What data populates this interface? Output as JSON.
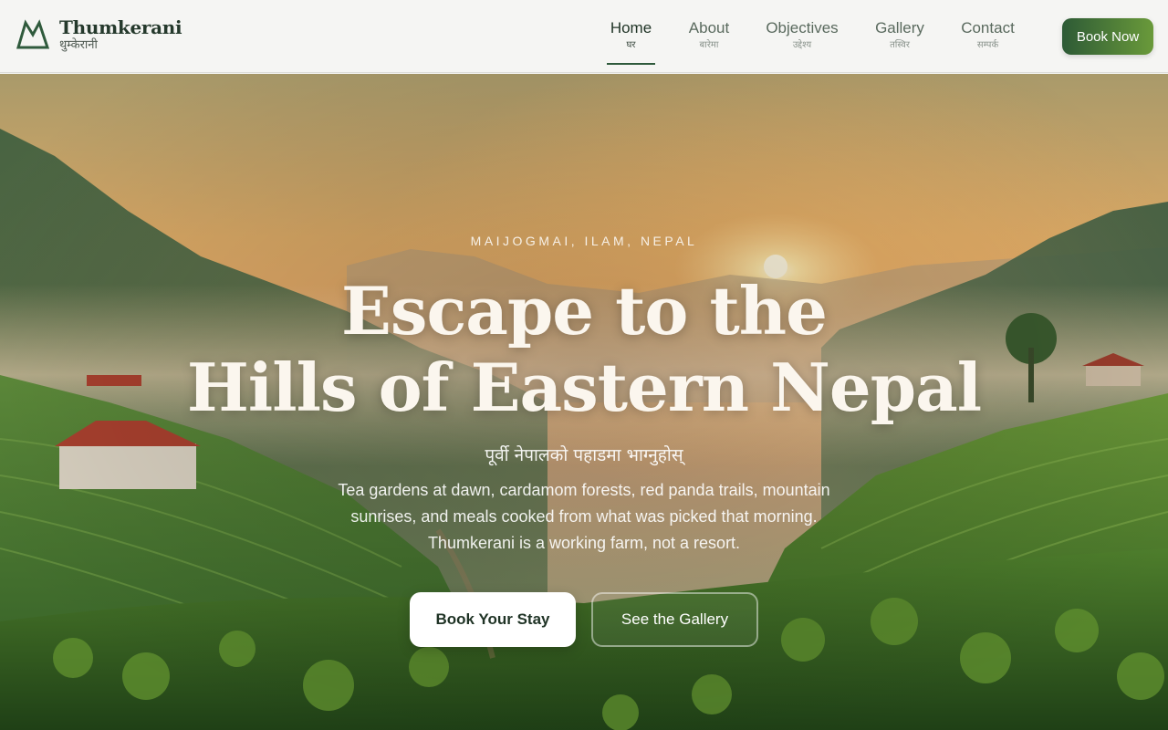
{
  "brand": {
    "name": "Thumkerani",
    "subtitle": "थुम्केरानी",
    "logo_icon": "mountain-icon",
    "accent": "#2f5a3c"
  },
  "nav": {
    "items": [
      {
        "label": "Home",
        "sub": "घर",
        "active": true
      },
      {
        "label": "About",
        "sub": "बारेमा",
        "active": false
      },
      {
        "label": "Objectives",
        "sub": "उद्देश्य",
        "active": false
      },
      {
        "label": "Gallery",
        "sub": "तस्विर",
        "active": false
      },
      {
        "label": "Contact",
        "sub": "सम्पर्क",
        "active": false
      }
    ],
    "book_now": "Book Now"
  },
  "hero": {
    "eyebrow": "MAIJOGMAI, ILAM, NEPAL",
    "headline_line1": "Escape to the",
    "headline_line2": "Hills of Eastern Nepal",
    "subtitle_np": "पूर्वी नेपालको पहाडमा भाग्नुहोस्",
    "description": "Tea gardens at dawn, cardamom forests, red panda trails, mountain sunrises, and meals cooked from what was picked that morning. Thumkerani is a working farm, not a resort.",
    "primary_cta": "Book Your Stay",
    "secondary_cta": "See the Gallery",
    "background": "tea-garden-sunrise-hills"
  },
  "colors": {
    "header_bg": "#f5f5f3",
    "button_gradient_start": "#2d5a36",
    "button_gradient_end": "#6a9a3a",
    "headline": "#fbf6ee"
  }
}
